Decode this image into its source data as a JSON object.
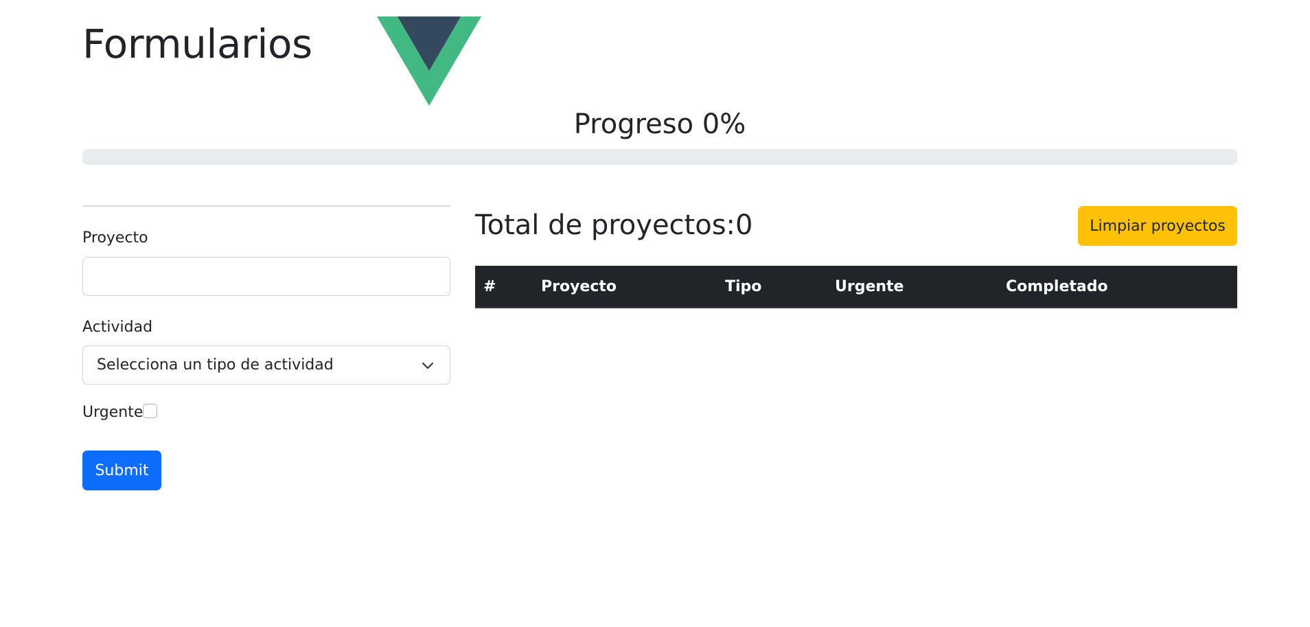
{
  "header": {
    "title": "Formularios"
  },
  "logo": {
    "icon": "vue-logo-icon",
    "colors": {
      "outer": "#42b883",
      "inner": "#35495e"
    }
  },
  "progress": {
    "label": "Progreso 0%",
    "value_percent": 0
  },
  "form": {
    "project_label": "Proyecto",
    "project_value": "",
    "activity_label": "Actividad",
    "activity_selected": "Selecciona un tipo de actividad",
    "urgent_label": "Urgente",
    "urgent_checked": false,
    "submit_label": "Submit"
  },
  "projects": {
    "total_label": "Total de proyectos:0",
    "clear_label": "Limpiar proyectos",
    "columns": [
      "#",
      "Proyecto",
      "Tipo",
      "Urgente",
      "Completado"
    ],
    "rows": []
  },
  "colors": {
    "primary": "#0d6efd",
    "warning": "#ffc107",
    "table_header": "#212529",
    "progress_track": "#e9ecef"
  }
}
